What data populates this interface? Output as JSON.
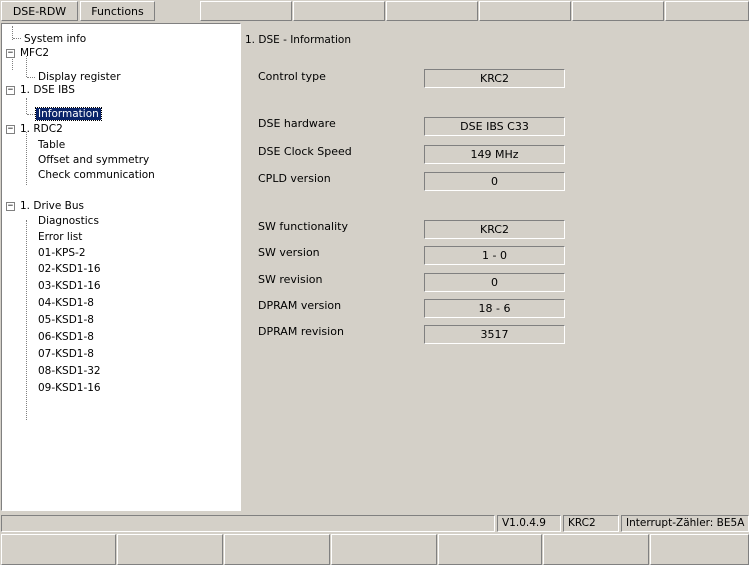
{
  "tabs": [
    {
      "label": "DSE-RDW"
    },
    {
      "label": "Functions"
    },
    {
      "label": ""
    },
    {
      "label": ""
    },
    {
      "label": ""
    },
    {
      "label": ""
    },
    {
      "label": ""
    },
    {
      "label": ""
    }
  ],
  "tree": {
    "items": [
      {
        "label": "System info"
      },
      {
        "label": "MFC2",
        "expander": "−"
      },
      {
        "label": "Display register"
      },
      {
        "label": "1. DSE IBS",
        "expander": "−"
      },
      {
        "label": "Information"
      },
      {
        "label": "1. RDC2",
        "expander": "−"
      },
      {
        "label": "Table"
      },
      {
        "label": "Offset and symmetry"
      },
      {
        "label": "Check communication"
      },
      {
        "label": "1. Drive Bus",
        "expander": "−"
      },
      {
        "label": "Diagnostics"
      },
      {
        "label": "Error list"
      },
      {
        "label": "01-KPS-2"
      },
      {
        "label": "02-KSD1-16"
      },
      {
        "label": "03-KSD1-16"
      },
      {
        "label": "04-KSD1-8"
      },
      {
        "label": "05-KSD1-8"
      },
      {
        "label": "06-KSD1-8"
      },
      {
        "label": "07-KSD1-8"
      },
      {
        "label": "08-KSD1-32"
      },
      {
        "label": "09-KSD1-16"
      }
    ]
  },
  "panel": {
    "title": "1. DSE - Information",
    "fields": [
      {
        "label": "Control type",
        "value": "KRC2"
      },
      {
        "label": "DSE hardware",
        "value": "DSE IBS C33"
      },
      {
        "label": "DSE Clock Speed",
        "value": "149 MHz"
      },
      {
        "label": "CPLD version",
        "value": "0"
      },
      {
        "label": "SW functionality",
        "value": "KRC2"
      },
      {
        "label": "SW version",
        "value": "1 - 0"
      },
      {
        "label": "SW revision",
        "value": "0"
      },
      {
        "label": "DPRAM version",
        "value": "18 - 6"
      },
      {
        "label": "DPRAM revision",
        "value": "3517"
      }
    ]
  },
  "statusbar": {
    "message": "",
    "version": "V1.0.4.9",
    "controller": "KRC2",
    "interrupt": "Interrupt-Zähler: BE5A"
  },
  "softkeys": [
    "",
    "",
    "",
    "",
    "",
    "",
    ""
  ],
  "colors": {
    "window_bg": "#d4d0c8",
    "tree_bg": "#ffffff",
    "selection_bg": "#0a246a",
    "selection_fg": "#ffffff"
  }
}
